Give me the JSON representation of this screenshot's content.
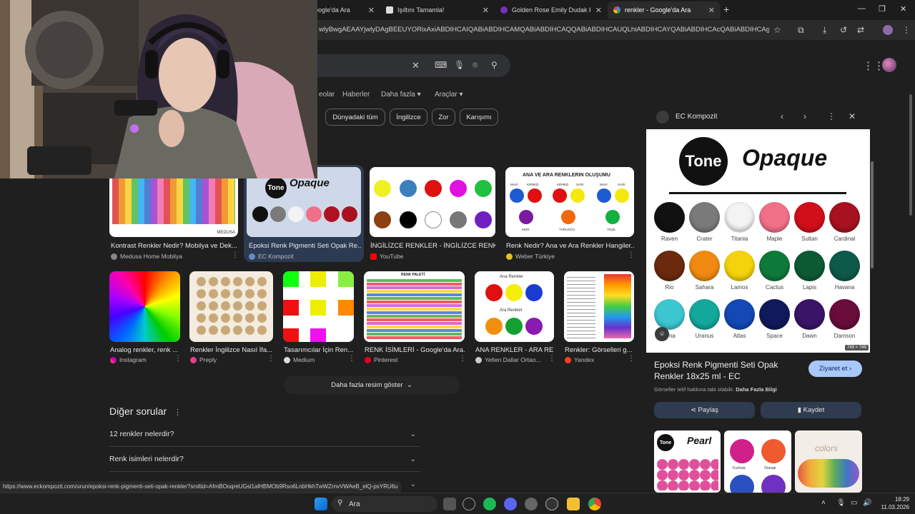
{
  "browser": {
    "tabs": [
      {
        "label": "oogle'da Ara",
        "close": "✕"
      },
      {
        "label": "Işıltını Tamamla!",
        "close": "✕"
      },
      {
        "label": "Golden Rose Emily Dudak Kalem",
        "close": "✕"
      },
      {
        "label": "renkler - Google'da Ara",
        "close": "✕"
      }
    ],
    "new_tab": "+",
    "window_controls": [
      "—",
      "❐",
      "✕"
    ],
    "url": "wlyBwgAEAAYjwlyDAgBEEUYORixAxiABDIHCAIQABiABDIHCAMQABiABDIHCAQQABiABDIHCAUQLhiABDIHCAYQABiABDIHCAcQABiABDIHCAgQABiABDI..."
  },
  "search": {
    "nav_tabs": [
      "eolar",
      "Haberler",
      "Daha fazla",
      "Araçlar"
    ],
    "chips": [
      "Dünyadaki tüm",
      "İngilizce",
      "Zor",
      "Karışımı"
    ]
  },
  "results_row1": [
    {
      "title": "Kontrast Renkler Nedir? Mobilya ve Dek...",
      "source": "Medusa Home Mobilya",
      "logo_text": "MEDUSA"
    },
    {
      "title": "Epoksi Renk Pigmenti Seti Opak Re...",
      "source": "EC Kompozit",
      "brand": "Tone",
      "brand2": "Opaque"
    },
    {
      "title": "İNGİLİZCE RENKLER - İNGİLİZCE RENKL...",
      "source": "YouTube"
    },
    {
      "title": "Renk Nedir? Ana ve Ara Renkler Hangiler...",
      "source": "Weber Türkiye",
      "header": "ANA VE ARA RENKLERIN OLUŞUMU",
      "labels": [
        "MAVİ",
        "KIRMIZI",
        "KIRMIZI",
        "SARI",
        "MAVİ",
        "SARI",
        "MOR",
        "TURUNCU",
        "YEŞİL"
      ]
    }
  ],
  "results_row2": [
    {
      "title": "Analog renkler, renk ...",
      "source": "Instagram"
    },
    {
      "title": "Renkler İngilizce Nasıl İfa...",
      "source": "Preply"
    },
    {
      "title": "Tasarımcılar İçin Ren...",
      "source": "Medium"
    },
    {
      "title": "RENK İSİMLERİ - Google'da Ara...",
      "source": "Pinterest",
      "header": "RENK PALETİ"
    },
    {
      "title": "ANA RENKLER - ARA RE...",
      "source": "Yelten Dallar Ortao...",
      "label1": "Ana Renkler",
      "label2": "Ara Renkler"
    },
    {
      "title": "Renkler: Görselleri g...",
      "source": "Yandex"
    }
  ],
  "more_images": "Daha fazla resim göster",
  "other_questions": {
    "heading": "Diğer sorular",
    "items": [
      "12 renkler nelerdir?",
      "Renk isimleri nelerdir?",
      ""
    ]
  },
  "status_url": "https://www.eckompozit.com/urun/epoksi-renk-pigmenti-seti-opak-renkler?srsltid=AfmBOoqreUGsl1alHBMOb9Rso6LnbHkhTwWZrnvVWAeB_elQ-psYRU6u",
  "panel": {
    "source": "EC Kompozit",
    "brand": "Tone",
    "brand2": "Opaque",
    "swatches": [
      {
        "name": "Raven",
        "color": "#111111"
      },
      {
        "name": "Crater",
        "color": "#7a7a7a"
      },
      {
        "name": "Titania",
        "color": "#f3f3f3"
      },
      {
        "name": "Maple",
        "color": "#f07088"
      },
      {
        "name": "Sultan",
        "color": "#d10f1a"
      },
      {
        "name": "Cardinal",
        "color": "#a8121e"
      },
      {
        "name": "Rio",
        "color": "#6b2a0e"
      },
      {
        "name": "Sahara",
        "color": "#f08a10"
      },
      {
        "name": "Lamos",
        "color": "#f4d20c"
      },
      {
        "name": "Cactus",
        "color": "#0e7a3a"
      },
      {
        "name": "Lapis",
        "color": "#0c5a34"
      },
      {
        "name": "Havana",
        "color": "#0e5a4a"
      },
      {
        "name": "Ama",
        "color": "#3cc6d0"
      },
      {
        "name": "Uranus",
        "color": "#13a89c"
      },
      {
        "name": "Atlas",
        "color": "#1448b4"
      },
      {
        "name": "Space",
        "color": "#101a5a"
      },
      {
        "name": "Dawn",
        "color": "#3a1466"
      },
      {
        "name": "Damson",
        "color": "#6a0c3a"
      }
    ],
    "dim": "749 × 749",
    "title": "Epoksi Renk Pigmenti Seti Opak Renkler 18x25 ml - EC",
    "visit": "Ziyaret et",
    "copyright": "Görseller telif hakkına tabi olabilir.",
    "more_info": "Daha Fazla Bilgi",
    "share": "Paylaş",
    "save": "Kaydet",
    "related": [
      {
        "brand": "Tone",
        "brand2": "Pearl",
        "l1": "Fuchsia",
        "l2": "Orange"
      },
      {
        "brand": "",
        "brand2": ""
      },
      {
        "brand": "colors",
        "brand2": ""
      }
    ]
  },
  "taskbar": {
    "search": "Ara",
    "time": "18:29",
    "date": "11.03.2026"
  }
}
